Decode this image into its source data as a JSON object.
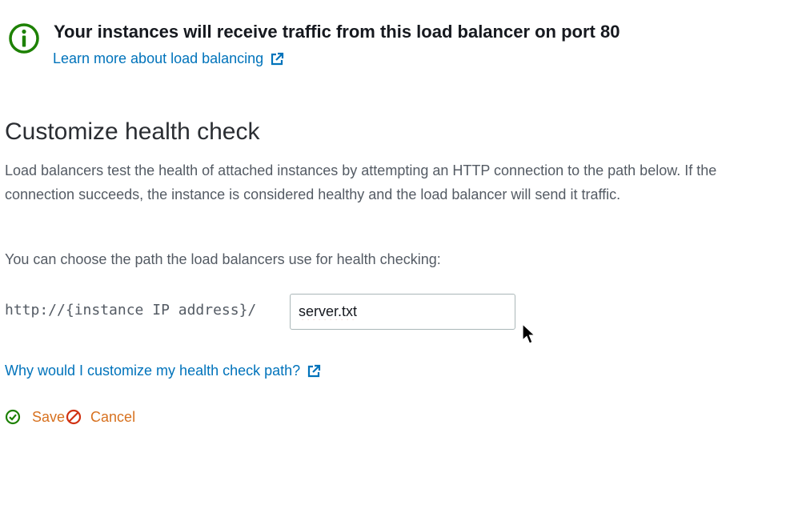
{
  "banner": {
    "icon": "info-icon",
    "title": "Your instances will receive traffic from this load balancer on port 80",
    "link_text": "Learn more about load balancing",
    "link_icon": "external-link-icon"
  },
  "section": {
    "title": "Customize health check",
    "description": "Load balancers test the health of attached instances by attempting an HTTP connection to the path below. If the connection succeeds, the instance is considered healthy and the load balancer will send it traffic.",
    "path_hint": "You can choose the path the load balancers use for health checking:"
  },
  "path": {
    "prefix": "http://{instance IP address}/",
    "value": "server.txt"
  },
  "help_link": {
    "text": "Why would I customize my health check path?",
    "icon": "external-link-icon"
  },
  "actions": {
    "save_label": "Save",
    "save_icon": "check-circle-icon",
    "cancel_label": "Cancel",
    "cancel_icon": "ban-icon"
  },
  "colors": {
    "success_green": "#1d8102",
    "link_blue": "#0073bb",
    "action_orange": "#d7711f",
    "cancel_red": "#d13212",
    "body_text": "#545b64",
    "heading_text": "#16191f"
  }
}
